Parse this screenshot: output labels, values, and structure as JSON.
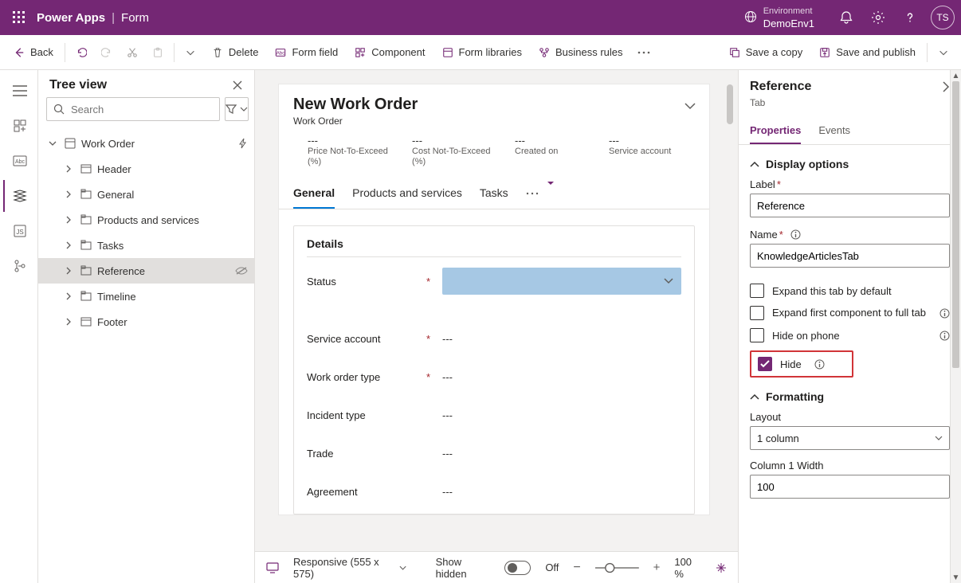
{
  "titlebar": {
    "brand": "Power Apps",
    "page": "Form",
    "env_label": "Environment",
    "env_value": "DemoEnv1",
    "avatar": "TS"
  },
  "commands": {
    "back": "Back",
    "delete": "Delete",
    "form_field": "Form field",
    "component": "Component",
    "form_libraries": "Form libraries",
    "business_rules": "Business rules",
    "save_copy": "Save a copy",
    "save_publish": "Save and publish"
  },
  "tree": {
    "title": "Tree view",
    "search_placeholder": "Search",
    "items": [
      {
        "label": "Work Order",
        "level": 1,
        "icon": "form",
        "open": true,
        "trail": "flash"
      },
      {
        "label": "Header",
        "level": 2,
        "icon": "section"
      },
      {
        "label": "General",
        "level": 2,
        "icon": "tab"
      },
      {
        "label": "Products and services",
        "level": 2,
        "icon": "tab"
      },
      {
        "label": "Tasks",
        "level": 2,
        "icon": "tab"
      },
      {
        "label": "Reference",
        "level": 2,
        "icon": "tab",
        "selected": true,
        "trail": "hidden"
      },
      {
        "label": "Timeline",
        "level": 2,
        "icon": "tab"
      },
      {
        "label": "Footer",
        "level": 2,
        "icon": "section"
      }
    ]
  },
  "form": {
    "title": "New Work Order",
    "subtitle": "Work Order",
    "meta": [
      {
        "value": "---",
        "label": "Price Not-To-Exceed (%)"
      },
      {
        "value": "---",
        "label": "Cost Not-To-Exceed (%)"
      },
      {
        "value": "---",
        "label": "Created on"
      },
      {
        "value": "---",
        "label": "Service account"
      }
    ],
    "tabs": [
      "General",
      "Products and services",
      "Tasks"
    ],
    "active_tab": 0,
    "section_title": "Details",
    "fields": [
      {
        "label": "Status",
        "required": true,
        "value": "",
        "dropdown": true
      },
      {
        "label": "Service account",
        "required": true,
        "value": "---"
      },
      {
        "label": "Work order type",
        "required": true,
        "value": "---"
      },
      {
        "label": "Incident type",
        "required": false,
        "value": "---"
      },
      {
        "label": "Trade",
        "required": false,
        "value": "---"
      },
      {
        "label": "Agreement",
        "required": false,
        "value": "---"
      }
    ]
  },
  "statusbar": {
    "responsive": "Responsive (555 x 575)",
    "show_hidden": "Show hidden",
    "off": "Off",
    "zoom": "100 %"
  },
  "props": {
    "title": "Reference",
    "type": "Tab",
    "tabs": [
      "Properties",
      "Events"
    ],
    "display_options": "Display options",
    "label_lbl": "Label",
    "label_val": "Reference",
    "name_lbl": "Name",
    "name_val": "KnowledgeArticlesTab",
    "expand_default": "Expand this tab by default",
    "expand_full": "Expand first component to full tab",
    "hide_phone": "Hide on phone",
    "hide": "Hide",
    "formatting": "Formatting",
    "layout_lbl": "Layout",
    "layout_val": "1 column",
    "col_width_lbl": "Column 1 Width",
    "col_width_val": "100"
  }
}
